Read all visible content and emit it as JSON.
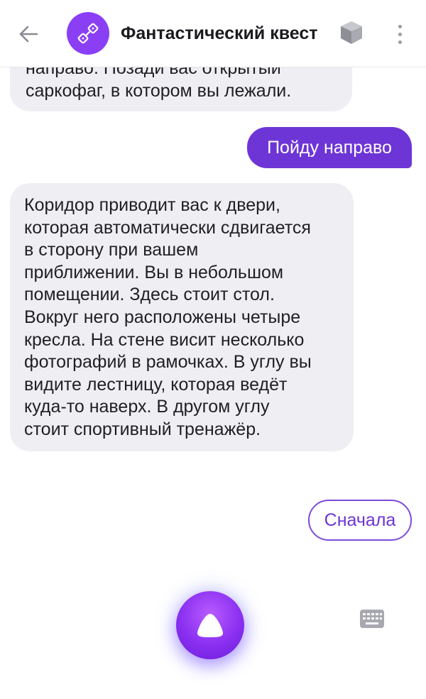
{
  "header": {
    "back_icon": "arrow-left-icon",
    "avatar_icon": "dice-link-icon",
    "title": "Фантастический квест",
    "cube_icon": "cube-icon",
    "menu_icon": "vertical-dots-icon"
  },
  "messages": [
    {
      "from": "alice",
      "lines": [
        "направо. Позади вас открытый",
        "саркофаг, в котором вы лежали."
      ]
    },
    {
      "from": "user",
      "text": "Пойду направо"
    },
    {
      "from": "alice",
      "lines": [
        "Коридор приводит вас к двери,",
        "которая автоматически сдвигается",
        "в сторону при вашем",
        "приближении. Вы в небольшом",
        "помещении. Здесь стоит стол.",
        "Вокруг него расположены четыре",
        "кресла. На стене висит несколько",
        "фотографий в рамочках. В углу вы",
        "видите лестницу, которая ведёт",
        "куда-то наверх. В другом углу",
        "стоит спортивный тренажёр."
      ]
    }
  ],
  "suggestion": "Сначала",
  "bottom": {
    "mic_icon": "alice-voice-icon",
    "keyboard_icon": "keyboard-icon"
  },
  "colors": {
    "accent": "#6d35d6",
    "bubble_in": "#efeff3",
    "avatar": "#8a3ff5"
  }
}
